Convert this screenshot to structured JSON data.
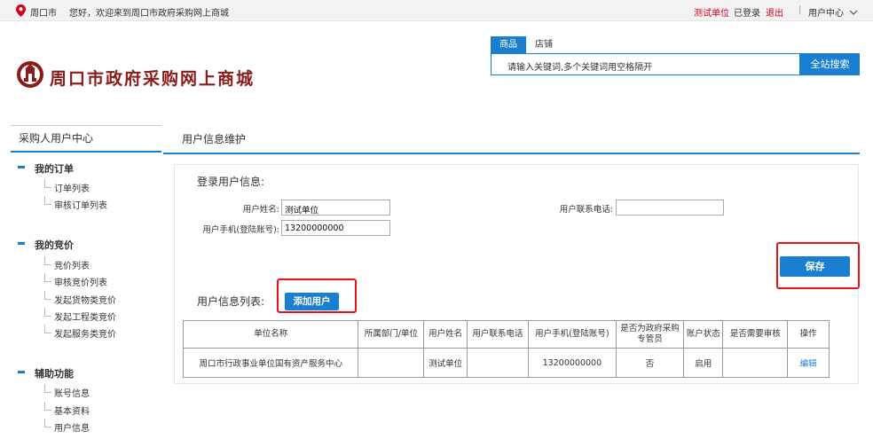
{
  "topbar": {
    "city": "周口市",
    "welcome": "您好，欢迎来到周口市政府采购网上商城",
    "org": "测试单位",
    "logged_in": "已登录",
    "logout": "退出",
    "user_center": "用户中心",
    "pin_icon": "location-pin-icon",
    "pin_color": "#d0021b"
  },
  "header": {
    "logo_text": "周口市政府采购网上商城",
    "brand_color": "#8b1a1a"
  },
  "search": {
    "tabs": [
      "商品",
      "店铺"
    ],
    "active_tab": "商品",
    "placeholder": "请输入关键词,多个关键词用空格隔开",
    "button": "全站搜索"
  },
  "sidebar": {
    "title": "采购人用户中心",
    "groups": [
      {
        "label": "我的订单",
        "items": [
          "订单列表",
          "审核订单列表"
        ]
      },
      {
        "label": "我的竞价",
        "items": [
          "竞价列表",
          "审核竞价列表",
          "发起货物类竞价",
          "发起工程类竞价",
          "发起服务类竞价"
        ]
      },
      {
        "label": "辅助功能",
        "items": [
          "账号信息",
          "基本资料",
          "用户信息"
        ]
      }
    ]
  },
  "main": {
    "title": "用户信息维护",
    "login_section": "登录用户信息:",
    "fields": {
      "name_label": "用户姓名:",
      "name_value": "测试单位",
      "phone_label": "用户联系电话:",
      "phone_value": "",
      "mobile_label": "用户手机(登陆账号):",
      "mobile_value": "13200000000"
    },
    "save_button": "保存",
    "list_section": "用户信息列表:",
    "add_button": "添加用户",
    "table": {
      "headers": [
        "单位名称",
        "所属部门/单位",
        "用户姓名",
        "用户联系电话",
        "用户手机(登陆账号)",
        "是否为政府采购专管员",
        "账户状态",
        "是否需要审核",
        "操作"
      ],
      "rows": [
        [
          "周口市行政事业单位国有资产服务中心",
          "",
          "测试单位",
          "",
          "13200000000",
          "否",
          "启用",
          "",
          "编辑"
        ]
      ]
    }
  },
  "colors": {
    "accent": "#1a7fd1",
    "highlight": "#e8131a"
  }
}
